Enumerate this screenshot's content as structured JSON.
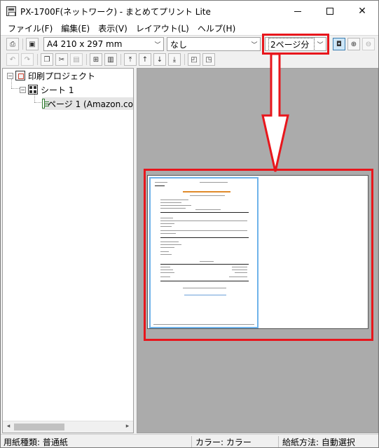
{
  "window": {
    "title": "PX-1700F(ネットワーク) - まとめてプリント Lite",
    "minimize_glyph": "",
    "maximize_glyph": "",
    "close_glyph": "✕"
  },
  "menubar": {
    "items": [
      {
        "label": "ファイル(F)"
      },
      {
        "label": "編集(E)"
      },
      {
        "label": "表示(V)"
      },
      {
        "label": "レイアウト(L)"
      },
      {
        "label": "ヘルプ(H)"
      }
    ]
  },
  "toolbar": {
    "paper_size": "A4 210 x 297 mm",
    "layout_option": "なし",
    "pages_per_sheet": "2ページ分",
    "icons": [
      "print-icon",
      "print-settings-icon",
      "fit-page-icon",
      "zoom-in-icon",
      "zoom-out-icon",
      "undo-icon",
      "redo-icon",
      "copy-icon",
      "cut-icon",
      "paste-icon",
      "new-sheet-icon",
      "delete-icon",
      "move-top-icon",
      "move-up-icon",
      "move-down-icon",
      "move-bottom-icon",
      "page-prev-icon",
      "page-next-icon"
    ]
  },
  "tree": {
    "root_label": "印刷プロジェクト",
    "sheet_label": "シート 1",
    "page_label": "ページ 1 (Amazon.co"
  },
  "statusbar": {
    "paper_type": "用紙種類: 普通紙",
    "color": "カラー: カラー",
    "feed": "給紙方法: 自動選択"
  },
  "annotation": {
    "color": "#e8161c"
  }
}
